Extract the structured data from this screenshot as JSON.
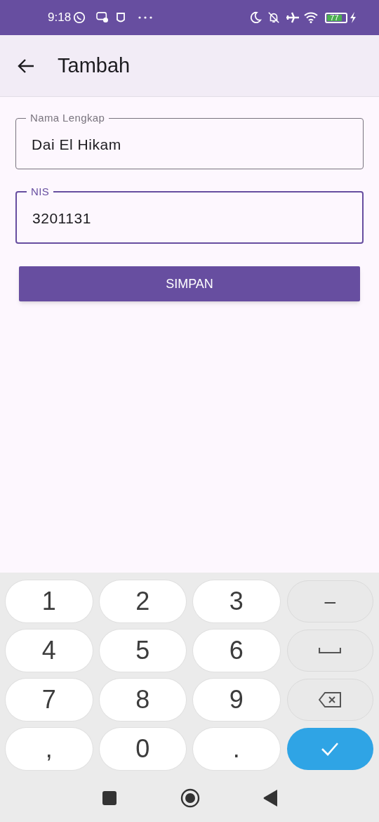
{
  "status_bar": {
    "time": "9:18",
    "battery": "77"
  },
  "app_bar": {
    "title": "Tambah"
  },
  "fields": [
    {
      "label": "Nama Lengkap",
      "value": "Dai El Hikam",
      "focused": false
    },
    {
      "label": "NIS",
      "value": "3201131",
      "focused": true
    }
  ],
  "save_button": {
    "label": "SIMPAN"
  },
  "keyboard": {
    "keys": [
      {
        "kind": "char",
        "label": "1"
      },
      {
        "kind": "char",
        "label": "2"
      },
      {
        "kind": "char",
        "label": "3"
      },
      {
        "kind": "function",
        "label": "–"
      },
      {
        "kind": "char",
        "label": "4"
      },
      {
        "kind": "char",
        "label": "5"
      },
      {
        "kind": "char",
        "label": "6"
      },
      {
        "kind": "space"
      },
      {
        "kind": "char",
        "label": "7"
      },
      {
        "kind": "char",
        "label": "8"
      },
      {
        "kind": "char",
        "label": "9"
      },
      {
        "kind": "backspace"
      },
      {
        "kind": "char",
        "label": ","
      },
      {
        "kind": "char",
        "label": "0"
      },
      {
        "kind": "char",
        "label": "."
      },
      {
        "kind": "done"
      }
    ]
  }
}
